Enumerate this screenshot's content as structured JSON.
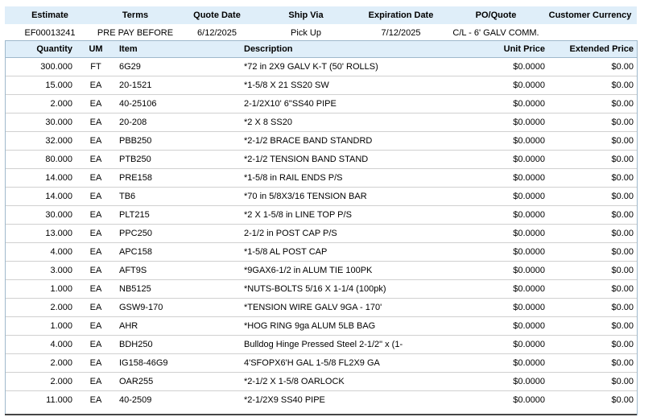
{
  "header": {
    "labels": [
      "Estimate",
      "Terms",
      "Quote Date",
      "Ship Via",
      "Expiration Date",
      "PO/Quote",
      "Customer Currency"
    ],
    "values": [
      "EF00013241",
      "PRE PAY BEFORE",
      "6/12/2025",
      "Pick Up",
      "7/12/2025",
      "C/L - 6' GALV COMM.",
      ""
    ]
  },
  "columns": {
    "quantity": "Quantity",
    "um": "UM",
    "item": "Item",
    "description": "Description",
    "unit_price": "Unit Price",
    "extended_price": "Extended Price"
  },
  "rows": [
    {
      "quantity": "300.000",
      "um": "FT",
      "item": "6G29",
      "description": "*72 in  2X9 GALV K-T (50' ROLLS)",
      "unit_price": "$0.0000",
      "extended_price": "$0.00"
    },
    {
      "quantity": "15.000",
      "um": "EA",
      "item": "20-1521",
      "description": "*1-5/8 X 21 SS20 SW",
      "unit_price": "$0.0000",
      "extended_price": "$0.00"
    },
    {
      "quantity": "2.000",
      "um": "EA",
      "item": "40-25106",
      "description": "2-1/2X10' 6\"SS40 PIPE",
      "unit_price": "$0.0000",
      "extended_price": "$0.00"
    },
    {
      "quantity": "30.000",
      "um": "EA",
      "item": "20-208",
      "description": "*2 X 8 SS20",
      "unit_price": "$0.0000",
      "extended_price": "$0.00"
    },
    {
      "quantity": "32.000",
      "um": "EA",
      "item": "PBB250",
      "description": "*2-1/2 BRACE BAND STANDRD",
      "unit_price": "$0.0000",
      "extended_price": "$0.00"
    },
    {
      "quantity": "80.000",
      "um": "EA",
      "item": "PTB250",
      "description": "*2-1/2 TENSION BAND STAND",
      "unit_price": "$0.0000",
      "extended_price": "$0.00"
    },
    {
      "quantity": "14.000",
      "um": "EA",
      "item": "PRE158",
      "description": "*1-5/8 in  RAIL ENDS P/S",
      "unit_price": "$0.0000",
      "extended_price": "$0.00"
    },
    {
      "quantity": "14.000",
      "um": "EA",
      "item": "TB6",
      "description": "*70 in  5/8X3/16 TENSION BAR",
      "unit_price": "$0.0000",
      "extended_price": "$0.00"
    },
    {
      "quantity": "30.000",
      "um": "EA",
      "item": "PLT215",
      "description": "*2 X 1-5/8 in  LINE TOP P/S",
      "unit_price": "$0.0000",
      "extended_price": "$0.00"
    },
    {
      "quantity": "13.000",
      "um": "EA",
      "item": "PPC250",
      "description": "2-1/2 in  POST CAP P/S",
      "unit_price": "$0.0000",
      "extended_price": "$0.00"
    },
    {
      "quantity": "4.000",
      "um": "EA",
      "item": "APC158",
      "description": "*1-5/8 AL POST CAP",
      "unit_price": "$0.0000",
      "extended_price": "$0.00"
    },
    {
      "quantity": "3.000",
      "um": "EA",
      "item": "AFT9S",
      "description": "*9GAX6-1/2 in  ALUM TIE 100PK",
      "unit_price": "$0.0000",
      "extended_price": "$0.00"
    },
    {
      "quantity": "1.000",
      "um": "EA",
      "item": "NB5125",
      "description": "*NUTS-BOLTS 5/16 X 1-1/4 (100pk)",
      "unit_price": "$0.0000",
      "extended_price": "$0.00"
    },
    {
      "quantity": "2.000",
      "um": "EA",
      "item": "GSW9-170",
      "description": "*TENSION WIRE GALV 9GA - 170'",
      "unit_price": "$0.0000",
      "extended_price": "$0.00"
    },
    {
      "quantity": "1.000",
      "um": "EA",
      "item": "AHR",
      "description": "*HOG RING 9ga ALUM 5LB BAG",
      "unit_price": "$0.0000",
      "extended_price": "$0.00"
    },
    {
      "quantity": "4.000",
      "um": "EA",
      "item": "BDH250",
      "description": "Bulldog Hinge Pressed Steel 2-1/2\" x (1-",
      "unit_price": "$0.0000",
      "extended_price": "$0.00"
    },
    {
      "quantity": "2.000",
      "um": "EA",
      "item": "IG158-46G9",
      "description": "4'SFOPX6'H GAL 1-5/8 FL2X9 GA",
      "unit_price": "$0.0000",
      "extended_price": "$0.00"
    },
    {
      "quantity": "2.000",
      "um": "EA",
      "item": "OAR255",
      "description": "*2-1/2 X 1-5/8 OARLOCK",
      "unit_price": "$0.0000",
      "extended_price": "$0.00"
    },
    {
      "quantity": "11.000",
      "um": "EA",
      "item": "40-2509",
      "description": "*2-1/2X9 SS40 PIPE",
      "unit_price": "$0.0000",
      "extended_price": "$0.00"
    }
  ]
}
